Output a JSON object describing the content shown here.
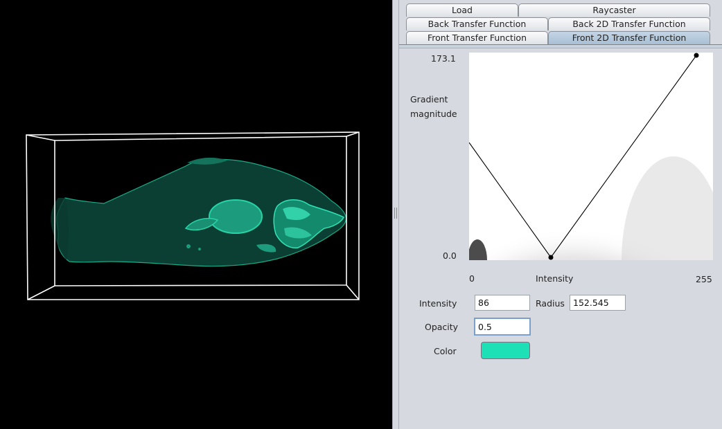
{
  "tabs": {
    "load": "Load",
    "raycaster": "Raycaster",
    "back_transfer": "Back Transfer Function",
    "back_2d_transfer": "Back 2D Transfer Function",
    "front_transfer": "Front Transfer Function",
    "front_2d_transfer": "Front 2D Transfer Function",
    "active": "front_2d_transfer"
  },
  "transfer_function_2d": {
    "y_axis_label_line1": "Gradient",
    "y_axis_label_line2": "magnitude",
    "y_max": "173.1",
    "y_min": "0.0",
    "x_min": "0",
    "x_max": "255",
    "x_axis_label": "Intensity"
  },
  "controls": {
    "intensity_label": "Intensity",
    "intensity_value": "86",
    "radius_label": "Radius",
    "radius_value": "152.545",
    "opacity_label": "Opacity",
    "opacity_value": "0.5",
    "color_label": "Color",
    "color_value": "#1ee0b6"
  },
  "render_color": "#1fc9a0"
}
